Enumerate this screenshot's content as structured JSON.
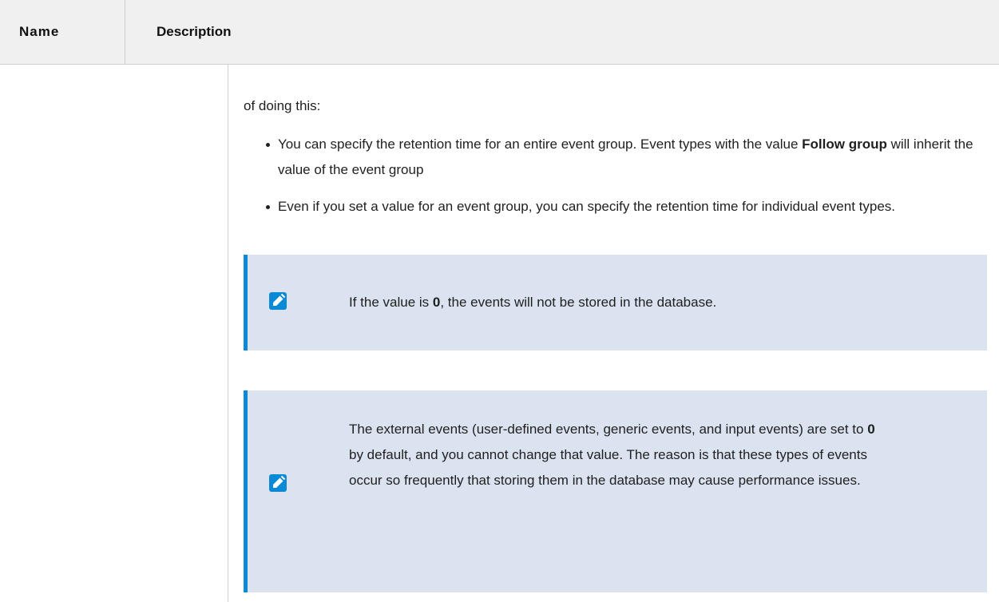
{
  "table": {
    "headers": {
      "name": "Name",
      "description": "Description"
    },
    "row": {
      "intro": "of doing this:",
      "bullets": [
        {
          "before": "You can specify the retention time for an entire event group. Event types with the value ",
          "bold": "Follow group",
          "after": " will inherit the value of the event group"
        },
        {
          "text": "Even if you set a value for an event group, you can specify the retention time for individual event types."
        }
      ],
      "notes": [
        {
          "icon": "pencil-icon",
          "before": "If the value is ",
          "bold": "0",
          "after": ", the events will not be stored in the database."
        },
        {
          "icon": "pencil-icon",
          "before": "The external events (user-defined events, generic events, and input events) are set to ",
          "bold": "0",
          "after": " by default, and you cannot change that value. The reason is that these types of events occur so frequently that storing them in the database may cause performance issues."
        }
      ]
    }
  },
  "colors": {
    "header_bg": "#f0f0f0",
    "note_bg": "#dbe3f1",
    "accent": "#0a8ad6"
  }
}
